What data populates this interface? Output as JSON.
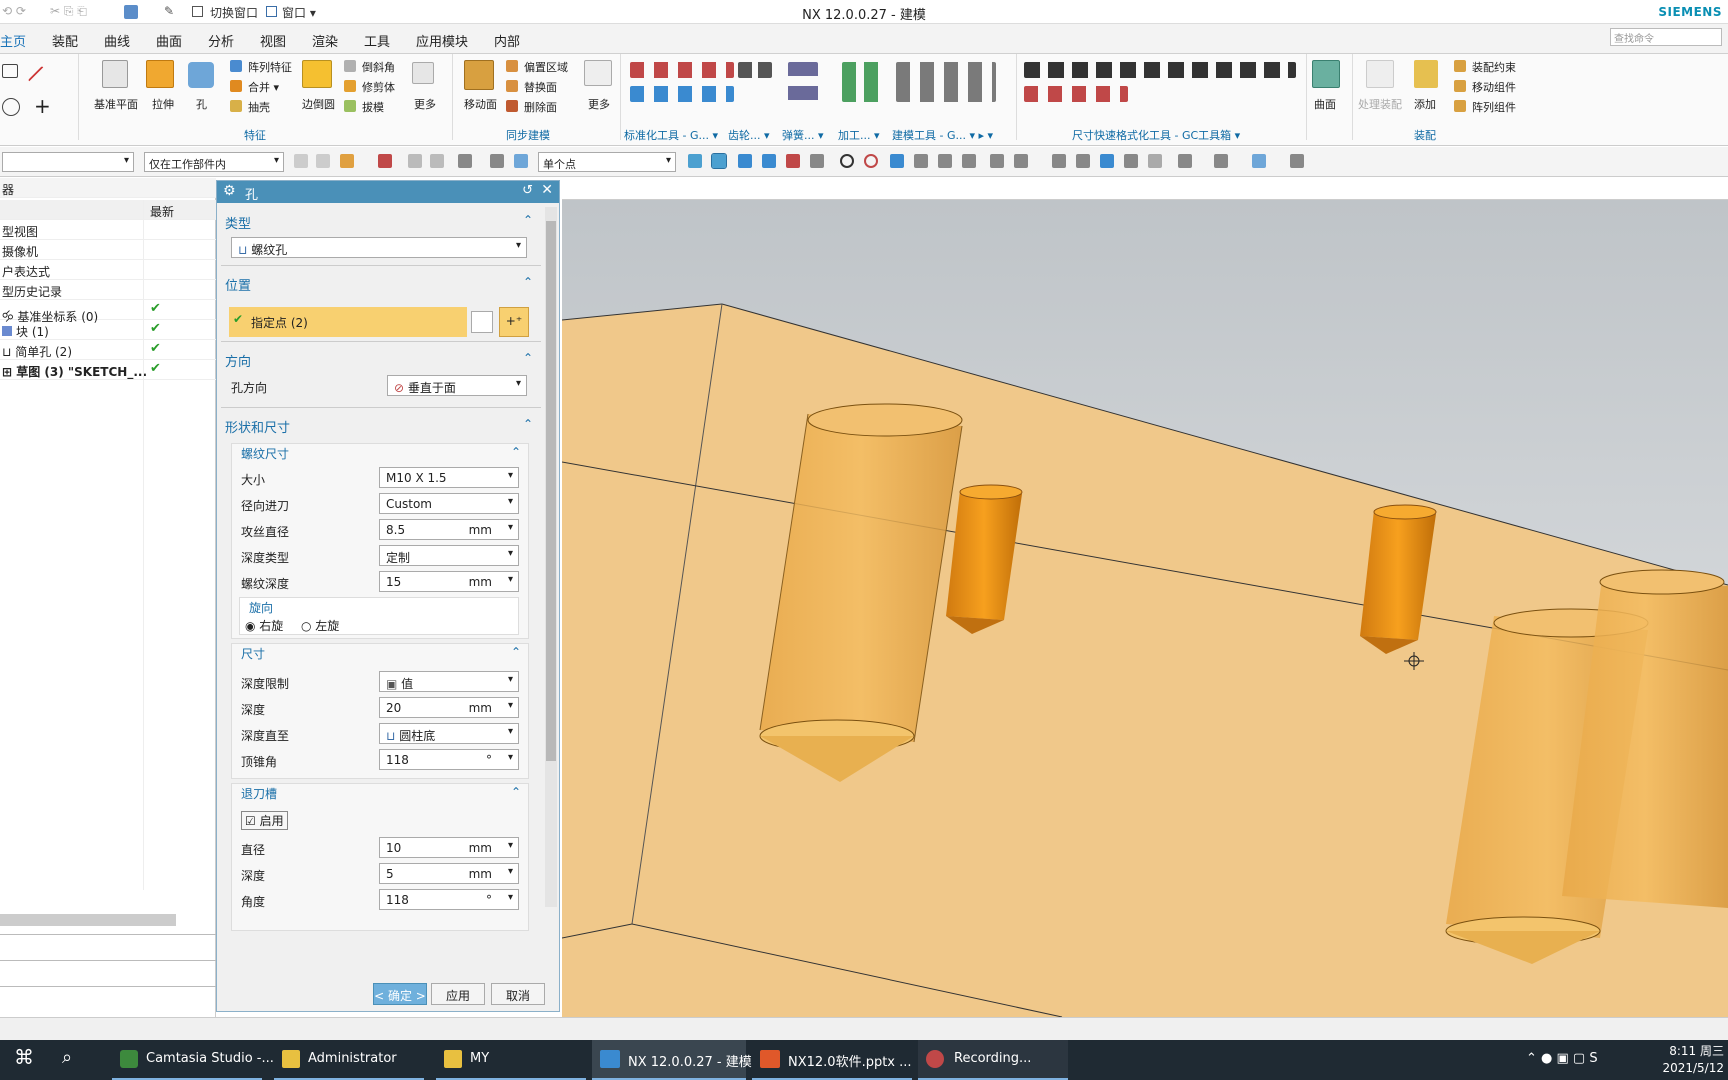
{
  "window": {
    "title": "NX 12.0.0.27 - 建模",
    "brand": "SIEMENS"
  },
  "qat": {
    "switch_window": "切换窗口",
    "window_menu": "窗口"
  },
  "menu": {
    "tabs": [
      "主页",
      "装配",
      "曲线",
      "曲面",
      "分析",
      "视图",
      "渲染",
      "工具",
      "应用模块",
      "内部"
    ],
    "search_placeholder": "查找命令"
  },
  "ribbon": {
    "feature": {
      "datum_plane": "基准平面",
      "extrude": "拉伸",
      "hole": "孔",
      "pattern_feature": "阵列特征",
      "unite": "合并",
      "shell": "抽壳",
      "draft_body": "边倒圆",
      "chamfer": "倒斜角",
      "trim_body": "修剪体",
      "draft": "拔模",
      "more": "更多",
      "group": "特征"
    },
    "sync": {
      "move_face": "移动面",
      "offset_region": "偏置区域",
      "replace": "替换面",
      "delete_face": "删除面",
      "more": "更多",
      "group": "同步建模"
    },
    "other_groups": [
      "标准化工具 - G...",
      "齿轮...",
      "弹簧...",
      "加工...",
      "建模工具 - G...",
      "尺寸快速格式化工具 - GC工具箱"
    ],
    "surface": {
      "label": "曲面"
    },
    "assembly": {
      "process": "处理装配",
      "add": "添加",
      "constraint": "装配约束",
      "move_component": "移动组件",
      "pattern_component": "阵列组件",
      "group": "装配"
    }
  },
  "toolbar": {
    "filter2": "仅在工作部件内",
    "snap": "单个点"
  },
  "nav": {
    "col_latest": "最新",
    "rows": [
      {
        "label": "型视图",
        "check": false
      },
      {
        "label": "摄像机",
        "check": false
      },
      {
        "label": "户表达式",
        "check": false
      },
      {
        "label": "型历史记录",
        "check": false
      },
      {
        "label": "基准坐标系 (0)",
        "check": true
      },
      {
        "label": "块 (1)",
        "check": true
      },
      {
        "label": "简单孔 (2)",
        "check": true
      },
      {
        "label": "草图 (3) \"SKETCH_...",
        "check": true
      }
    ]
  },
  "hole_dialog": {
    "title": "孔",
    "type_section": "类型",
    "type_value": "螺纹孔",
    "location_section": "位置",
    "specify_point": "指定点 (2)",
    "direction_section": "方向",
    "hole_direction_label": "孔方向",
    "hole_direction_value": "垂直于面",
    "shape_section": "形状和尺寸",
    "thread_sub": "螺纹尺寸",
    "size_label": "大小",
    "size_value": "M10 X 1.5",
    "radial_label": "径向进刀",
    "radial_value": "Custom",
    "tap_label": "攻丝直径",
    "tap_value": "8.5",
    "tap_unit": "mm",
    "depth_type_label": "深度类型",
    "depth_type_value": "定制",
    "thread_depth_label": "螺纹深度",
    "thread_depth_value": "15",
    "thread_depth_unit": "mm",
    "rotation_label": "旋向",
    "right_hand": "右旋",
    "left_hand": "左旋",
    "dim_sub": "尺寸",
    "depth_limit_label": "深度限制",
    "depth_limit_value": "值",
    "depth_label": "深度",
    "depth_value": "20",
    "depth_unit": "mm",
    "depth_to_label": "深度直至",
    "depth_to_value": "圆柱底",
    "tip_angle_label": "顶锥角",
    "tip_angle_value": "118",
    "tip_angle_unit": "°",
    "relief_sub": "退刀槽",
    "enable_label": "启用",
    "diameter_label": "直径",
    "diameter_value": "10",
    "diameter_unit": "mm",
    "relief_depth_label": "深度",
    "relief_depth_value": "5",
    "relief_depth_unit": "mm",
    "angle_label": "角度",
    "angle_value": "118",
    "angle_unit": "°",
    "ok": "< 确定 >",
    "apply": "应用",
    "cancel": "取消"
  },
  "taskbar": {
    "items": [
      "Camtasia Studio -...",
      "Administrator",
      "MY",
      "NX 12.0.0.27 - 建模",
      "NX12.0软件.pptx ...",
      "Recording..."
    ],
    "time": "8:11 周三",
    "date": "2021/5/12"
  }
}
